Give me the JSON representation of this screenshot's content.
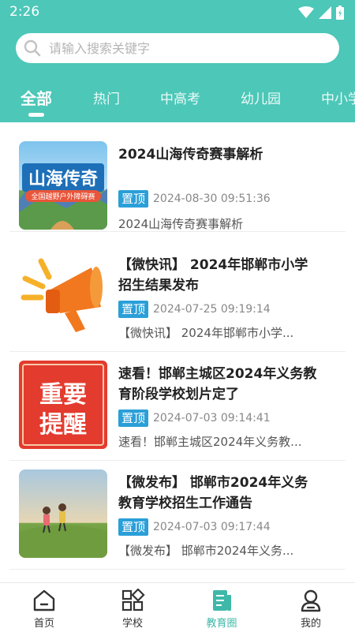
{
  "status_bar": {
    "time": "2:26",
    "icons": [
      "wifi-icon",
      "signal-icon",
      "battery-icon"
    ]
  },
  "search": {
    "placeholder": "请输入搜索关键字",
    "icon": "search-icon"
  },
  "tabs": [
    {
      "label": "全部",
      "active": true
    },
    {
      "label": "热门",
      "active": false
    },
    {
      "label": "中高考",
      "active": false
    },
    {
      "label": "幼儿园",
      "active": false
    },
    {
      "label": "中小学",
      "active": false
    }
  ],
  "articles": [
    {
      "title": "2024山海传奇赛事解析",
      "pin": "置顶",
      "date": "2024-08-30 09:51:36",
      "summary": "2024山海传奇赛事解析",
      "thumb": {
        "main_text": "山海传奇",
        "sub_text": "全国越野户外障碍赛"
      }
    },
    {
      "title": "【微快讯】 2024年邯郸市小学招生结果发布",
      "pin": "置顶",
      "date": "2024-07-25 09:19:14",
      "summary": "【微快讯】 2024年邯郸市小学...",
      "thumb": {
        "icon": "megaphone-icon"
      }
    },
    {
      "title": " 速看！邯郸主城区2024年义务教育阶段学校划片定了",
      "pin": "置顶",
      "date": "2024-07-03 09:14:41",
      "summary": "速看！邯郸主城区2024年义务教...",
      "thumb": {
        "line1": "重要",
        "line2": "提醒"
      }
    },
    {
      "title": "【微发布】 邯郸市2024年义务教育学校招生工作通告",
      "pin": "置顶",
      "date": "2024-07-03 09:17:44",
      "summary": "【微发布】 邯郸市2024年义务...",
      "thumb": {
        "scene": "children-on-hill"
      }
    }
  ],
  "bottom_nav": [
    {
      "label": "首页",
      "icon": "home-icon",
      "active": false
    },
    {
      "label": "学校",
      "icon": "school-grid-icon",
      "active": false
    },
    {
      "label": "教育圈",
      "icon": "document-icon",
      "active": true
    },
    {
      "label": "我的",
      "icon": "profile-icon",
      "active": false
    }
  ],
  "colors": {
    "primary": "#4cc7b8",
    "pin_badge": "#2a9fd8",
    "active_nav": "#3fb8a9"
  }
}
